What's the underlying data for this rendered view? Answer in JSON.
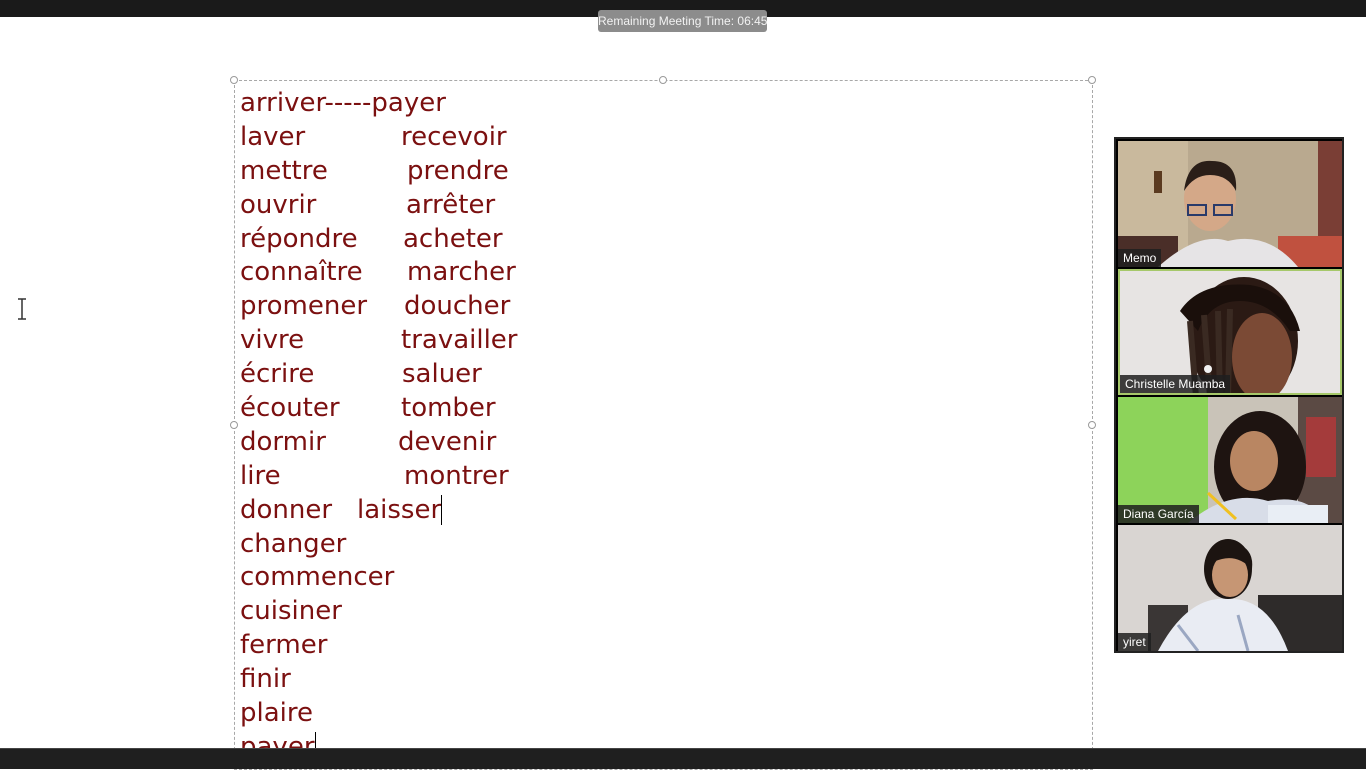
{
  "meeting": {
    "remaining_time": "Remaining Meeting Time: 06:45"
  },
  "slide": {
    "text_color": "#7b1010",
    "lines": [
      {
        "left": "arriver-----payer",
        "right": ""
      },
      {
        "left": "laver",
        "right": "recevoir"
      },
      {
        "left": "mettre",
        "right": "prendre"
      },
      {
        "left": "ouvrir",
        "right": "arrêter"
      },
      {
        "left": "répondre",
        "right": "acheter"
      },
      {
        "left": "connaître",
        "right": "marcher"
      },
      {
        "left": "promener",
        "right": "doucher"
      },
      {
        "left": "vivre",
        "right": "travailler"
      },
      {
        "left": "écrire",
        "right": "saluer"
      },
      {
        "left": "écouter",
        "right": "tomber"
      },
      {
        "left": "dormir",
        "right": "devenir"
      },
      {
        "left": "lire",
        "right": "montrer"
      },
      {
        "left": "donner",
        "right": "laisser"
      },
      {
        "left": "changer",
        "right": ""
      },
      {
        "left": "commencer",
        "right": ""
      },
      {
        "left": "cuisiner",
        "right": ""
      },
      {
        "left": "fermer",
        "right": ""
      },
      {
        "left": "finir",
        "right": ""
      },
      {
        "left": "plaire",
        "right": ""
      },
      {
        "left": "payer",
        "right": ""
      }
    ]
  },
  "participants": [
    {
      "name": "Memo",
      "active": false
    },
    {
      "name": "Christelle Muamba",
      "active": true
    },
    {
      "name": "Diana García",
      "active": false
    },
    {
      "name": "yiret",
      "active": false
    }
  ],
  "colors": {
    "active_speaker_border": "#a6c86a"
  },
  "icons": {
    "text_cursor": "text-cursor-icon"
  }
}
